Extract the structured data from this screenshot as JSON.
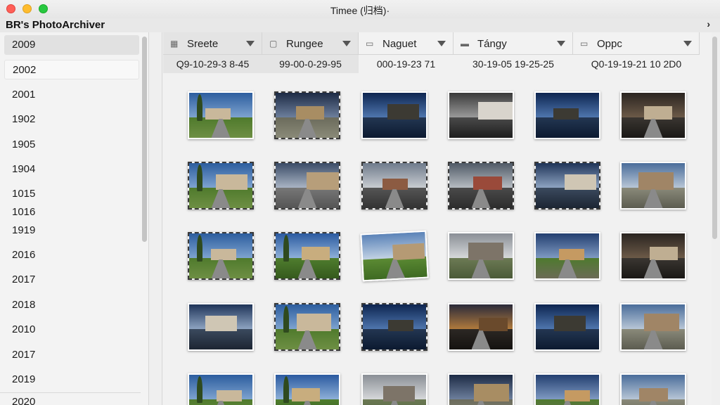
{
  "window": {
    "title": "Timee (归档)·"
  },
  "app": {
    "title": "BR's PhotoArchiver"
  },
  "sidebar": {
    "items": [
      "2009",
      "2002",
      "2001",
      "1902",
      "1905",
      "1904",
      "1015",
      "1016",
      "1919",
      "2016",
      "2017",
      "2018",
      "2010",
      "2017",
      "2019",
      "2020"
    ],
    "selected_index": 0,
    "hover_index": 1
  },
  "columns": [
    {
      "label": "Sreete",
      "icon": "grid-icon",
      "date": "Q9-10-29-3 8-45",
      "active": true
    },
    {
      "label": "Rungee",
      "icon": "square-icon",
      "date": "99-00-0-29-95",
      "active": true
    },
    {
      "label": "Naguet",
      "icon": "monitor-icon",
      "date": "000-19-23 71",
      "active": false
    },
    {
      "label": "Tángy",
      "icon": "folder-icon",
      "date": "30-19-05 19-25-25",
      "active": false
    },
    {
      "label": "Oppc",
      "icon": "drive-icon",
      "date": "Q0-19-19-21 10 2D0",
      "active": false
    }
  ],
  "colors": {
    "accent": "#e4e4e4",
    "close": "#ff5f57",
    "minimize": "#febc2e",
    "maximize": "#28c840"
  },
  "photos": [
    {
      "scene": "manor-trees",
      "style": "plain"
    },
    {
      "scene": "courtyard-dusk",
      "style": "dashed"
    },
    {
      "scene": "lake-reflection",
      "style": "plain"
    },
    {
      "scene": "colonnade-dark",
      "style": "plain"
    },
    {
      "scene": "lake-reflection",
      "style": "plain"
    },
    {
      "scene": "corridor",
      "style": "plain"
    },
    {
      "scene": "manor-trees",
      "style": "dashed"
    },
    {
      "scene": "courtyard-car",
      "style": "dashed"
    },
    {
      "scene": "alley-car",
      "style": "dashed"
    },
    {
      "scene": "brick-car",
      "style": "dashed"
    },
    {
      "scene": "colonnade-water",
      "style": "dashed"
    },
    {
      "scene": "cottage",
      "style": "plain"
    },
    {
      "scene": "manor-trees",
      "style": "dashed"
    },
    {
      "scene": "manor-path",
      "style": "dashed"
    },
    {
      "scene": "manor-lawn",
      "style": "tilt"
    },
    {
      "scene": "chateau-grey",
      "style": "plain"
    },
    {
      "scene": "manor-lit",
      "style": "plain"
    },
    {
      "scene": "corridor",
      "style": "plain"
    },
    {
      "scene": "colonnade-water",
      "style": "plain"
    },
    {
      "scene": "manor-trees",
      "style": "dashed"
    },
    {
      "scene": "lake-reflection",
      "style": "dashed"
    },
    {
      "scene": "sunset-street",
      "style": "plain"
    },
    {
      "scene": "lake-reflection",
      "style": "plain"
    },
    {
      "scene": "cottage",
      "style": "plain"
    },
    {
      "scene": "manor-trees",
      "style": "plain"
    },
    {
      "scene": "manor-path",
      "style": "plain"
    },
    {
      "scene": "chateau-grey",
      "style": "plain"
    },
    {
      "scene": "courtyard-dusk",
      "style": "plain"
    },
    {
      "scene": "manor-lit",
      "style": "plain"
    },
    {
      "scene": "cottage",
      "style": "plain"
    }
  ]
}
